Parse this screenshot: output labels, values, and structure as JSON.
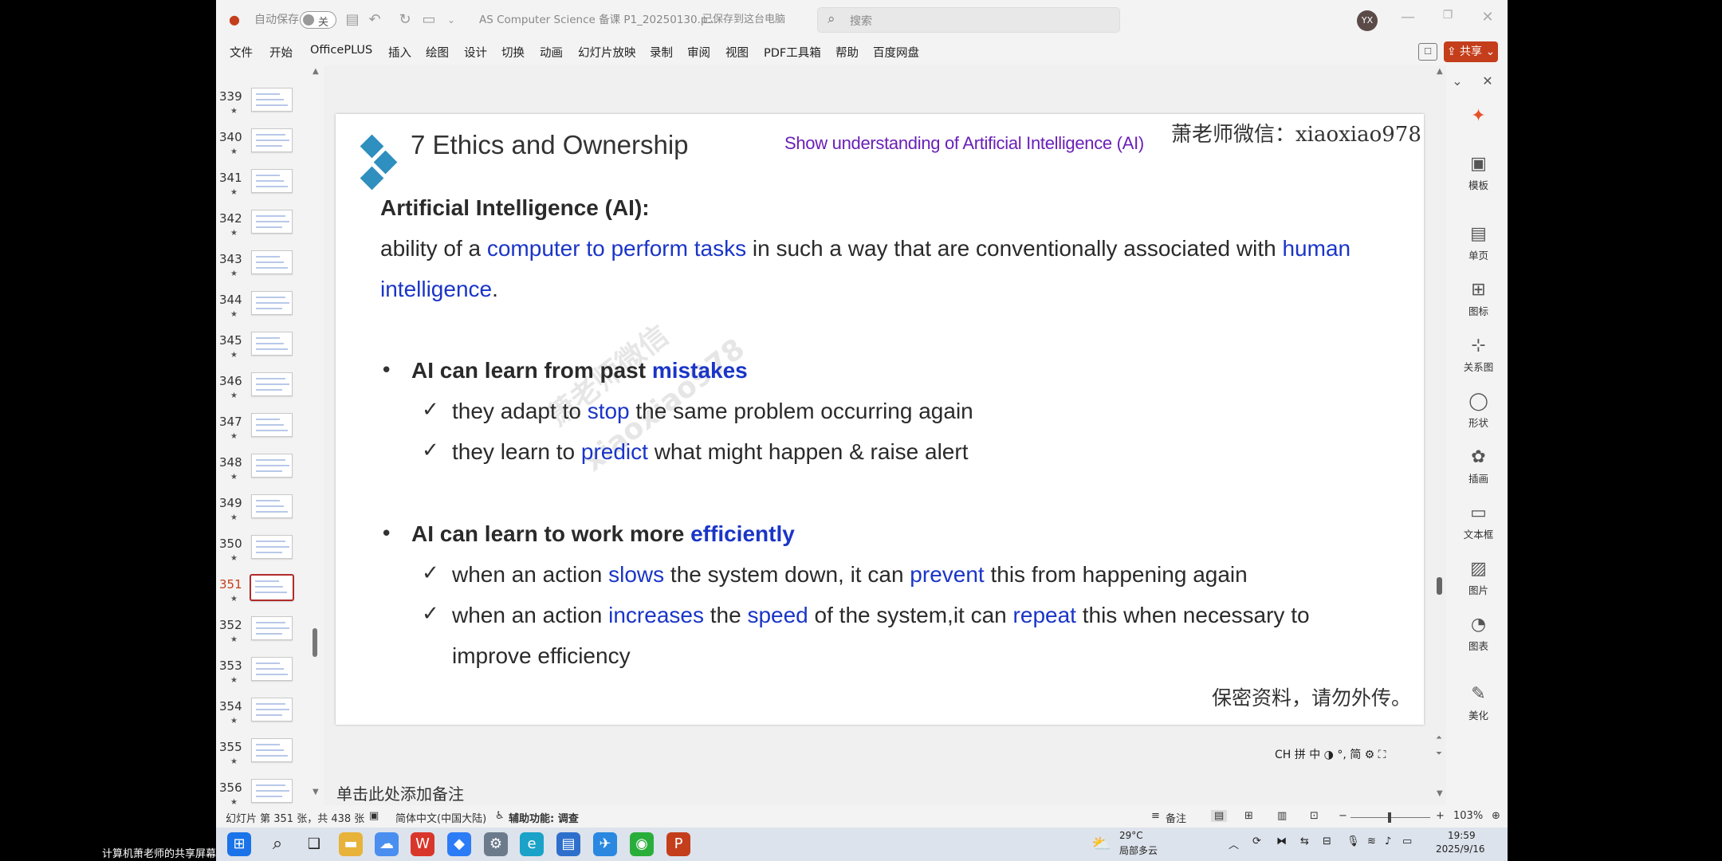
{
  "titlebar": {
    "autosave_label": "自动保存",
    "autosave_state": "关",
    "doc_title": "AS Computer Science 备课 P1_20250130.p...",
    "save_status": "已保存到这台电脑",
    "search_placeholder": "搜索",
    "avatar_initials": "YX"
  },
  "menu": {
    "items": [
      "文件",
      "开始",
      "OfficePLUS",
      "插入",
      "绘图",
      "设计",
      "切换",
      "动画",
      "幻灯片放映",
      "录制",
      "审阅",
      "视图",
      "PDF工具箱",
      "帮助",
      "百度网盘"
    ],
    "share_label": "共享"
  },
  "thumbnails": {
    "numbers": [
      "339",
      "340",
      "341",
      "342",
      "343",
      "344",
      "345",
      "346",
      "347",
      "348",
      "349",
      "350",
      "351",
      "352",
      "353",
      "354",
      "355",
      "356"
    ],
    "star": "★",
    "active": "351"
  },
  "slide": {
    "title": "7 Ethics and Ownership",
    "subtitle": "Show understanding of Artificial Intelligence (AI)",
    "wechat": "萧老师微信：xiaoxiao978",
    "watermark": "萧老师微信",
    "watermark2": "xiaoxiao978",
    "ai_heading": "Artificial Intelligence (AI):",
    "def_line1": {
      "p1": "ability of a ",
      "p2": "computer to perform tasks",
      "p3": " in such a way that are conventionally associated with ",
      "p4": "human"
    },
    "def_line2": {
      "p1": "intelligence",
      "p2": "."
    },
    "bullet1": {
      "p1": "AI can learn from past ",
      "p2": "mistakes"
    },
    "b1c1": {
      "p1": "they adapt to ",
      "p2": "stop",
      "p3": " the same problem occurring again"
    },
    "b1c2": {
      "p1": "they learn to ",
      "p2": "predict",
      "p3": " what might happen & raise alert"
    },
    "bullet2": {
      "p1": "AI can learn to work more ",
      "p2": "efficiently"
    },
    "b2c1": {
      "p1": "when an action ",
      "p2": "slows",
      "p3": " the system down, it can ",
      "p4": "prevent",
      "p5": " this from happening again"
    },
    "b2c2": {
      "p1": "when an action ",
      "p2": "increases",
      "p3": " the ",
      "p4": "speed",
      "p5": " of the system,it can ",
      "p6": "repeat",
      "p7": " this when necessary to"
    },
    "b2c3": "improve efficiency",
    "confidential": "保密资料，请勿外传。",
    "bullet_glyph": "•",
    "check_glyph": "✓"
  },
  "notes_placeholder": "单击此处添加备注",
  "ime_bar": "CH 拼 中 ◑ °, 简 ⚙ ⛶",
  "sidepanel": [
    {
      "label": "模板",
      "icon": "template-icon"
    },
    {
      "label": "单页",
      "icon": "single-page-icon"
    },
    {
      "label": "图标",
      "icon": "icons-icon"
    },
    {
      "label": "关系图",
      "icon": "diagram-icon"
    },
    {
      "label": "形状",
      "icon": "shape-icon"
    },
    {
      "label": "插画",
      "icon": "illustration-icon"
    },
    {
      "label": "文本框",
      "icon": "textbox-icon"
    },
    {
      "label": "图片",
      "icon": "picture-icon"
    },
    {
      "label": "图表",
      "icon": "chart-icon"
    },
    {
      "label": "美化",
      "icon": "beautify-icon"
    }
  ],
  "status": {
    "slide_info": "幻灯片 第 351 张，共 438 张",
    "language": "简体中文(中国大陆)",
    "accessibility": "辅助功能: 调查",
    "notes": "备注",
    "zoom": "103%"
  },
  "taskbar": {
    "weather_temp": "29°C",
    "weather_desc": "局部多云",
    "time": "19:59",
    "date": "2025/9/16",
    "share_screen_label": "计算机萧老师的共享屏幕"
  },
  "colors": {
    "accent_red": "#c43e1c",
    "slide_blue": "#1a35c7",
    "subtitle_purple": "#6a1fb8",
    "diamond_blue": "#2f8fbf"
  }
}
